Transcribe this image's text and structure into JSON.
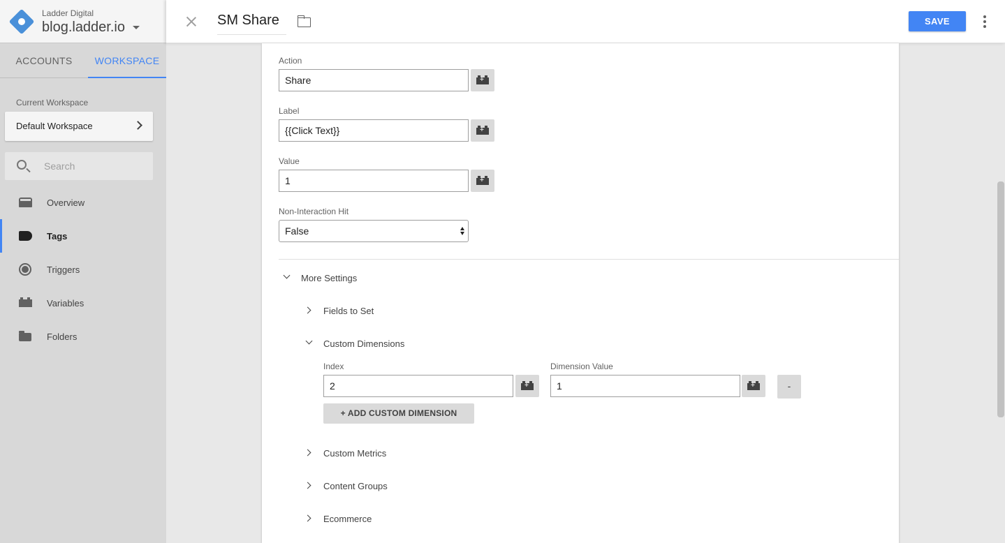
{
  "sidebar": {
    "account_name": "Ladder Digital",
    "container_name": "blog.ladder.io",
    "tabs": [
      {
        "label": "ACCOUNTS"
      },
      {
        "label": "WORKSPACE"
      }
    ],
    "current_workspace_label": "Current Workspace",
    "current_workspace_value": "Default Workspace",
    "search_placeholder": "Search",
    "nav": [
      {
        "label": "Overview",
        "icon": "overview-icon"
      },
      {
        "label": "Tags",
        "icon": "tag-icon",
        "active": true
      },
      {
        "label": "Triggers",
        "icon": "trigger-icon"
      },
      {
        "label": "Variables",
        "icon": "variable-icon"
      },
      {
        "label": "Folders",
        "icon": "folder-icon"
      }
    ]
  },
  "header": {
    "title": "SM Share",
    "save_label": "SAVE",
    "accent_color": "#4285f4"
  },
  "form": {
    "action": {
      "label": "Action",
      "value": "Share"
    },
    "label": {
      "label": "Label",
      "value": "{{Click Text}}"
    },
    "value": {
      "label": "Value",
      "value": "1"
    },
    "non_interaction": {
      "label": "Non-Interaction Hit",
      "value": "False"
    }
  },
  "more_settings": {
    "title": "More Settings",
    "sections": {
      "fields_to_set": "Fields to Set",
      "custom_dimensions": "Custom Dimensions",
      "custom_metrics": "Custom Metrics",
      "content_groups": "Content Groups",
      "ecommerce": "Ecommerce"
    },
    "custom_dimension": {
      "index_label": "Index",
      "index_value": "2",
      "dimension_label": "Dimension Value",
      "dimension_value": "1",
      "remove_label": "-",
      "add_label": "+ ADD CUSTOM DIMENSION"
    }
  }
}
